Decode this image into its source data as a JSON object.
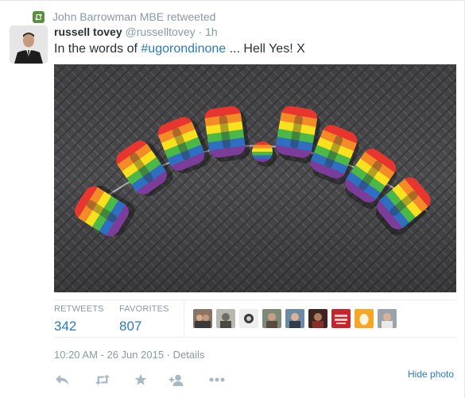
{
  "retweet_context": {
    "text": "John Barrowman MBE retweeted"
  },
  "tweet": {
    "display_name": "russell tovey",
    "handle": "@russelltovey",
    "separator": "·",
    "time": "1h",
    "text_before": "In the words of ",
    "hashtag": "#ugorondinone",
    "text_after": " ... Hell Yes! X"
  },
  "photo": {
    "sculpture_letters": [
      "H",
      "E",
      "L",
      "L",
      ".",
      "Y",
      "E",
      "S",
      "!"
    ],
    "stripe_colors": [
      "#e8352e",
      "#f38b26",
      "#f9e11f",
      "#4cb848",
      "#2e6fc1",
      "#7b3c9a"
    ]
  },
  "stats": {
    "retweets_label": "RETWEETS",
    "retweets_value": "342",
    "favorites_label": "FAVORITES",
    "favorites_value": "807"
  },
  "favoriters": [
    {
      "name": "avatar-1"
    },
    {
      "name": "avatar-2"
    },
    {
      "name": "avatar-3"
    },
    {
      "name": "avatar-4"
    },
    {
      "name": "avatar-5"
    },
    {
      "name": "avatar-6"
    },
    {
      "name": "avatar-7"
    },
    {
      "name": "avatar-8"
    },
    {
      "name": "avatar-9"
    }
  ],
  "meta": {
    "timestamp": "10:20 AM - 26 Jun 2015",
    "separator": "·",
    "details_label": "Details"
  },
  "actions": {
    "reply_icon": "reply-icon",
    "retweet_icon": "retweet-icon",
    "favorite_icon": "star-icon",
    "follow_icon": "follow-icon",
    "more_icon": "more-icon",
    "hide_photo_label": "Hide photo"
  },
  "colors": {
    "link": "#2b7bb9",
    "muted": "#8899a6",
    "retweet_green": "#5c913b",
    "text": "#292f33"
  }
}
